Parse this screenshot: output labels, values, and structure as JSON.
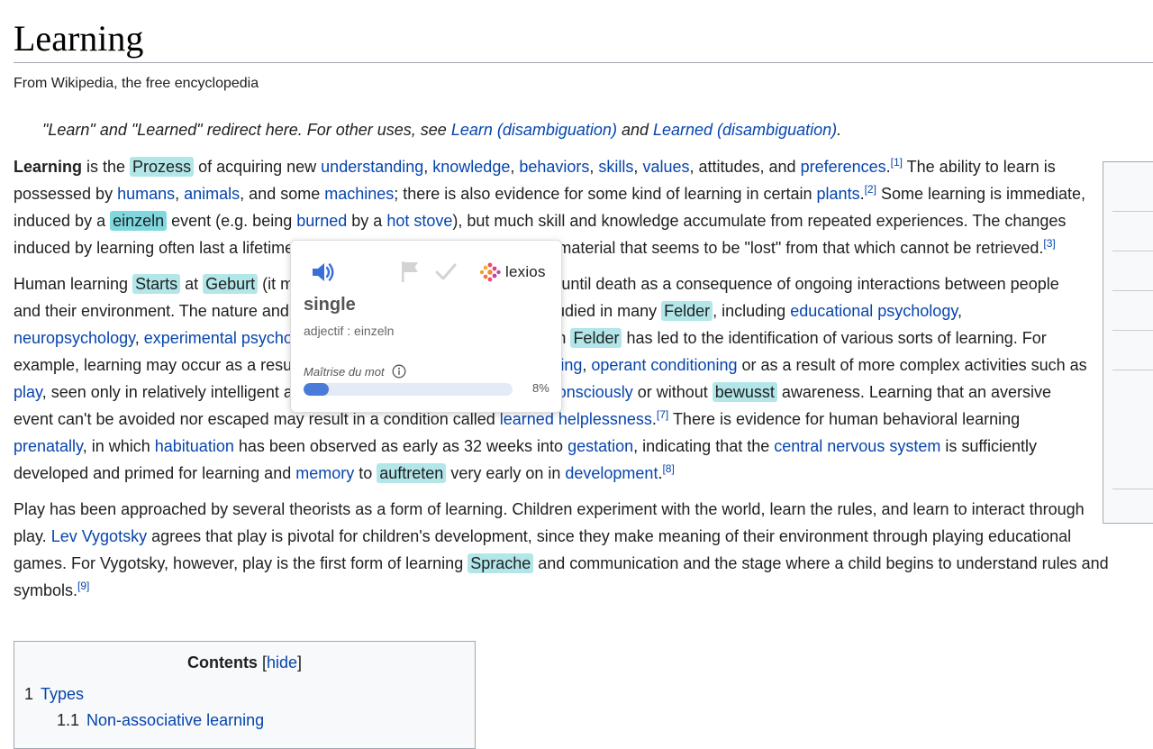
{
  "article": {
    "title": "Learning",
    "tagline": "From Wikipedia, the free encyclopedia",
    "hatnote": {
      "prefix": "\"Learn\" and \"Learned\" redirect here. For other uses, see ",
      "link1": "Learn (disambiguation)",
      "middle": " and ",
      "link2": "Learned (disambiguation)",
      "suffix": "."
    }
  },
  "toc": {
    "title": "Contents",
    "hide_open": "[",
    "hide_label": "hide",
    "hide_close": "]",
    "items": [
      {
        "num": "1",
        "label": "Types"
      },
      {
        "num": "1.1",
        "label": "Non-associative learning"
      }
    ]
  },
  "popup": {
    "brand": "lexios",
    "word": "single",
    "pos": "adjectif : einzeln",
    "mastery_label": "Maîtrise du mot",
    "mastery_value": 0.08,
    "mastery_text": "8%"
  },
  "colors": {
    "link": "#0645ad",
    "highlight": "#b2e6e9",
    "speaker": "#3a6fd8",
    "progress": "#4a7bd8"
  },
  "icons": [
    "speaker-icon",
    "flag-icon",
    "check-icon",
    "lexios-logo",
    "info-icon"
  ]
}
